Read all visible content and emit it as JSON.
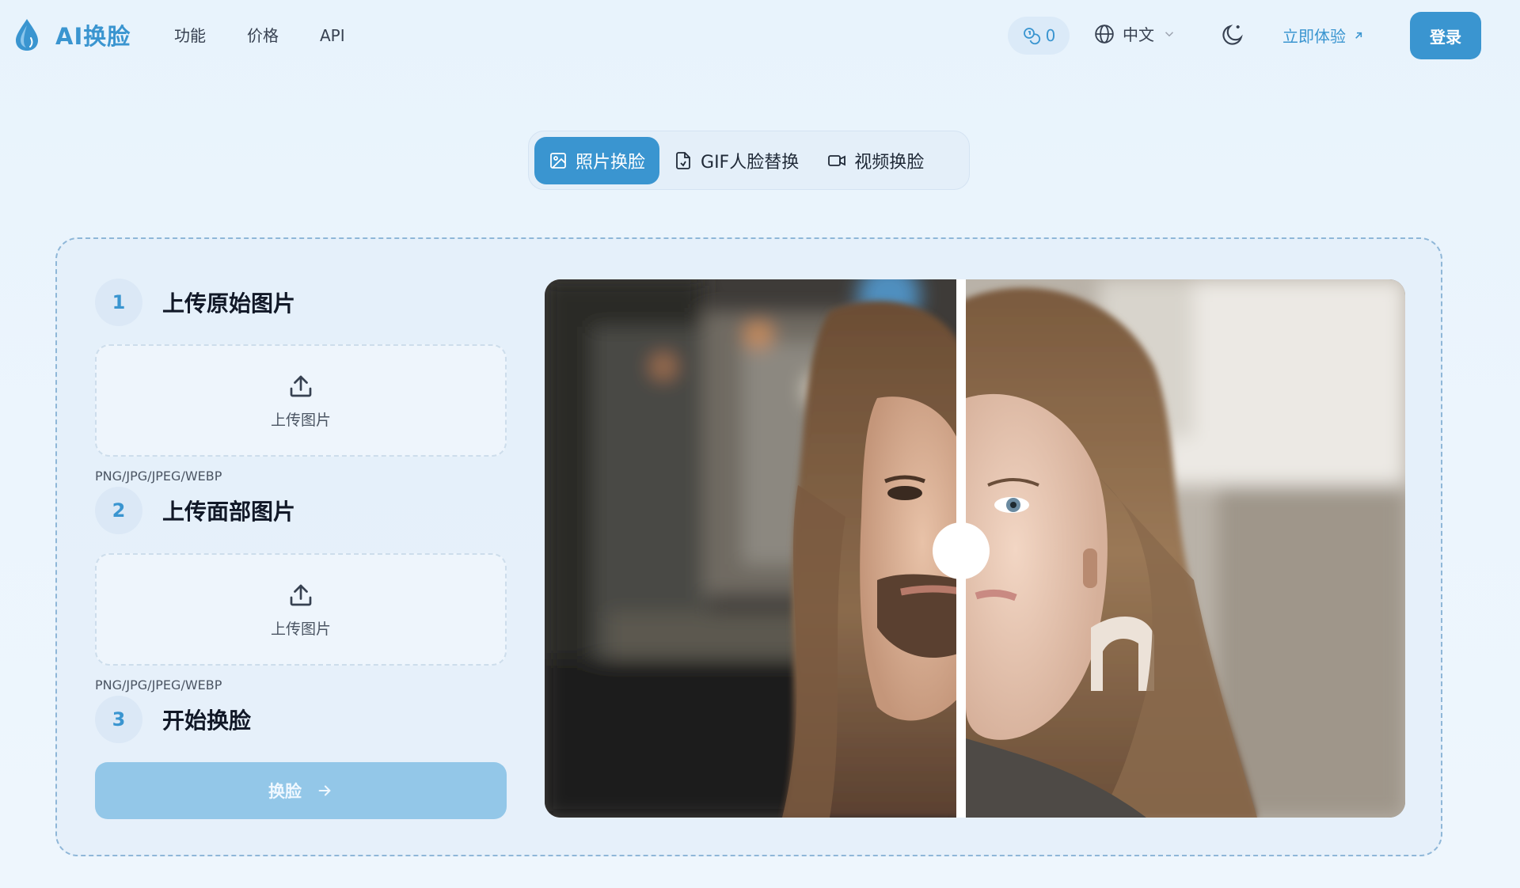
{
  "header": {
    "logo_text": "AI换脸",
    "nav": [
      "功能",
      "价格",
      "API"
    ],
    "credits": "0",
    "language": "中文",
    "try_now": "立即体验",
    "login": "登录"
  },
  "tabs": [
    {
      "label": "照片换脸",
      "icon": "image-icon",
      "active": true
    },
    {
      "label": "GIF人脸替换",
      "icon": "gif-file-icon",
      "active": false
    },
    {
      "label": "视频换脸",
      "icon": "video-camera-icon",
      "active": false
    }
  ],
  "steps": [
    {
      "number": "1",
      "title": "上传原始图片",
      "upload_label": "上传图片",
      "formats": "PNG/JPG/JPEG/WEBP"
    },
    {
      "number": "2",
      "title": "上传面部图片",
      "upload_label": "上传图片",
      "formats": "PNG/JPG/JPEG/WEBP"
    },
    {
      "number": "3",
      "title": "开始换脸"
    }
  ],
  "swap_button": "换脸",
  "comparison": {
    "slider_position": 0.486
  },
  "colors": {
    "accent": "#3a95d0",
    "accent_light": "#93c7e8",
    "background": "#eaf4fc"
  }
}
